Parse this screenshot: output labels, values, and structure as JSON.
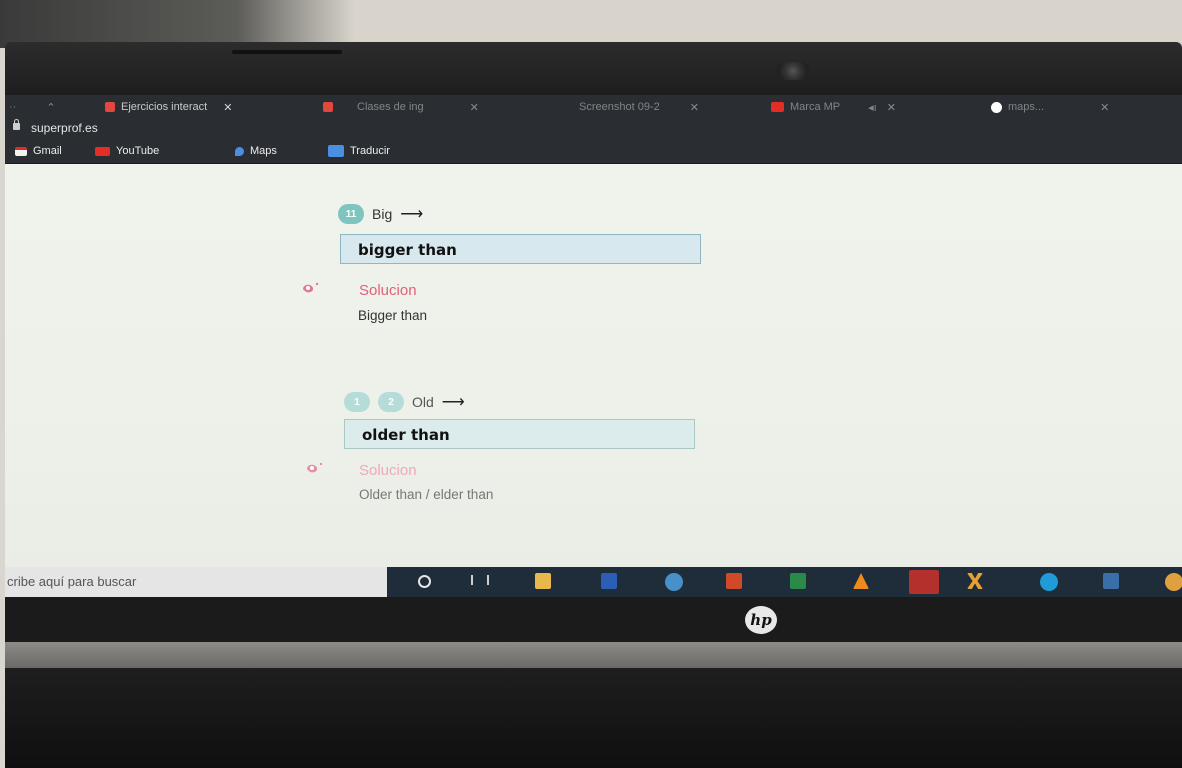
{
  "browser": {
    "tabs": [
      {
        "label": "",
        "icon": "tab-edge-icon"
      },
      {
        "label": "Ejercicios interact",
        "icon": "superprof-icon"
      },
      {
        "label": "Clases de ing",
        "icon": "superprof-icon"
      },
      {
        "label": "Screenshot 09-2",
        "icon": "image-icon"
      },
      {
        "label": "Marca MP",
        "icon": "youtube-icon"
      },
      {
        "label": "maps...",
        "icon": "google-icon"
      }
    ],
    "url": "superprof.es",
    "bookmarks": [
      {
        "label": "Gmail",
        "icon": "gmail-icon"
      },
      {
        "label": "YouTube",
        "icon": "youtube-icon"
      },
      {
        "label": "Maps",
        "icon": "maps-icon"
      },
      {
        "label": "Traducir",
        "icon": "translate-icon"
      }
    ]
  },
  "exercises": [
    {
      "number": "11",
      "prompt": "Big",
      "answer": "bigger than",
      "solution_label": "Solucion",
      "solution_text": "Bigger than"
    },
    {
      "number_digits": [
        "1",
        "2"
      ],
      "prompt": "Old",
      "answer": "older than",
      "solution_label": "Solucion",
      "solution_text": "Older than / elder than"
    }
  ],
  "arrow": "⟶",
  "taskbar": {
    "search_placeholder": "cribe aquí para buscar",
    "apps": [
      "cortana-icon",
      "task-view-icon",
      "file-explorer-icon",
      "word-icon",
      "chrome-icon",
      "powerpoint-icon",
      "excel-icon",
      "vlc-icon",
      "acrobat-icon",
      "xmind-icon",
      "edge-icon",
      "media-icon",
      "app-icon"
    ]
  },
  "device": {
    "logo": "hp"
  },
  "colors": {
    "accent_teal": "#7ec4bf",
    "answer_bg": "#d7e9ee",
    "solution_pink": "#e0607a",
    "taskbar": "#1f2c3a"
  }
}
